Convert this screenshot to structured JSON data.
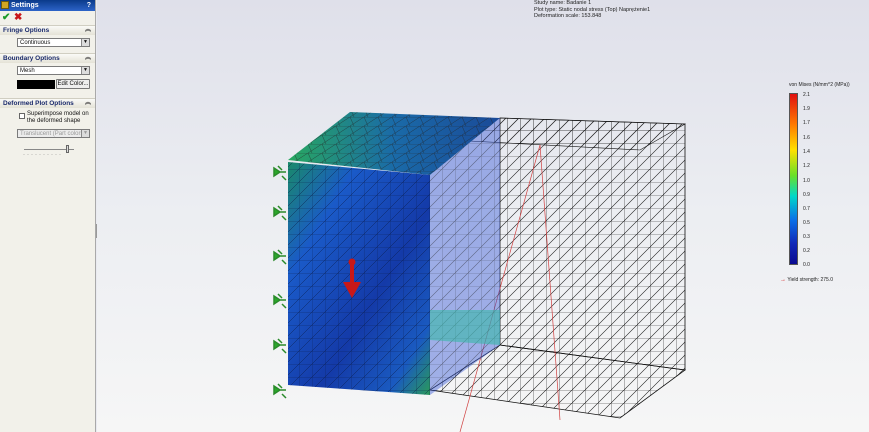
{
  "panel": {
    "title": "Settings",
    "help": "?",
    "ok_icon": "check-icon",
    "cancel_icon": "close-icon",
    "fringe": {
      "title": "Fringe Options",
      "select": "Continuous"
    },
    "boundary": {
      "title": "Boundary Options",
      "select": "Mesh",
      "color_swatch": "#000000",
      "edit_color": "Edit Color..."
    },
    "deformed": {
      "title": "Deformed Plot Options",
      "superimpose": "Superimpose model on the deformed shape",
      "select": "Translucent (Part colors)"
    }
  },
  "study": {
    "line1": "Study name: Badanie 1",
    "line2": "Plot type: Static nodal stress (Top) Naprężenie1",
    "line3": "Deformation scale: 153.848"
  },
  "legend": {
    "title": "von Mises (N/mm^2 (MPa))",
    "ticks": [
      "2.1",
      "1.9",
      "1.7",
      "1.6",
      "1.4",
      "1.2",
      "1.0",
      "0.9",
      "0.7",
      "0.5",
      "0.3",
      "0.2",
      "0.0"
    ],
    "yield": "Yield strength: 275.0",
    "colors": {
      "max": "#e01010",
      "min": "#0a0a90"
    }
  }
}
